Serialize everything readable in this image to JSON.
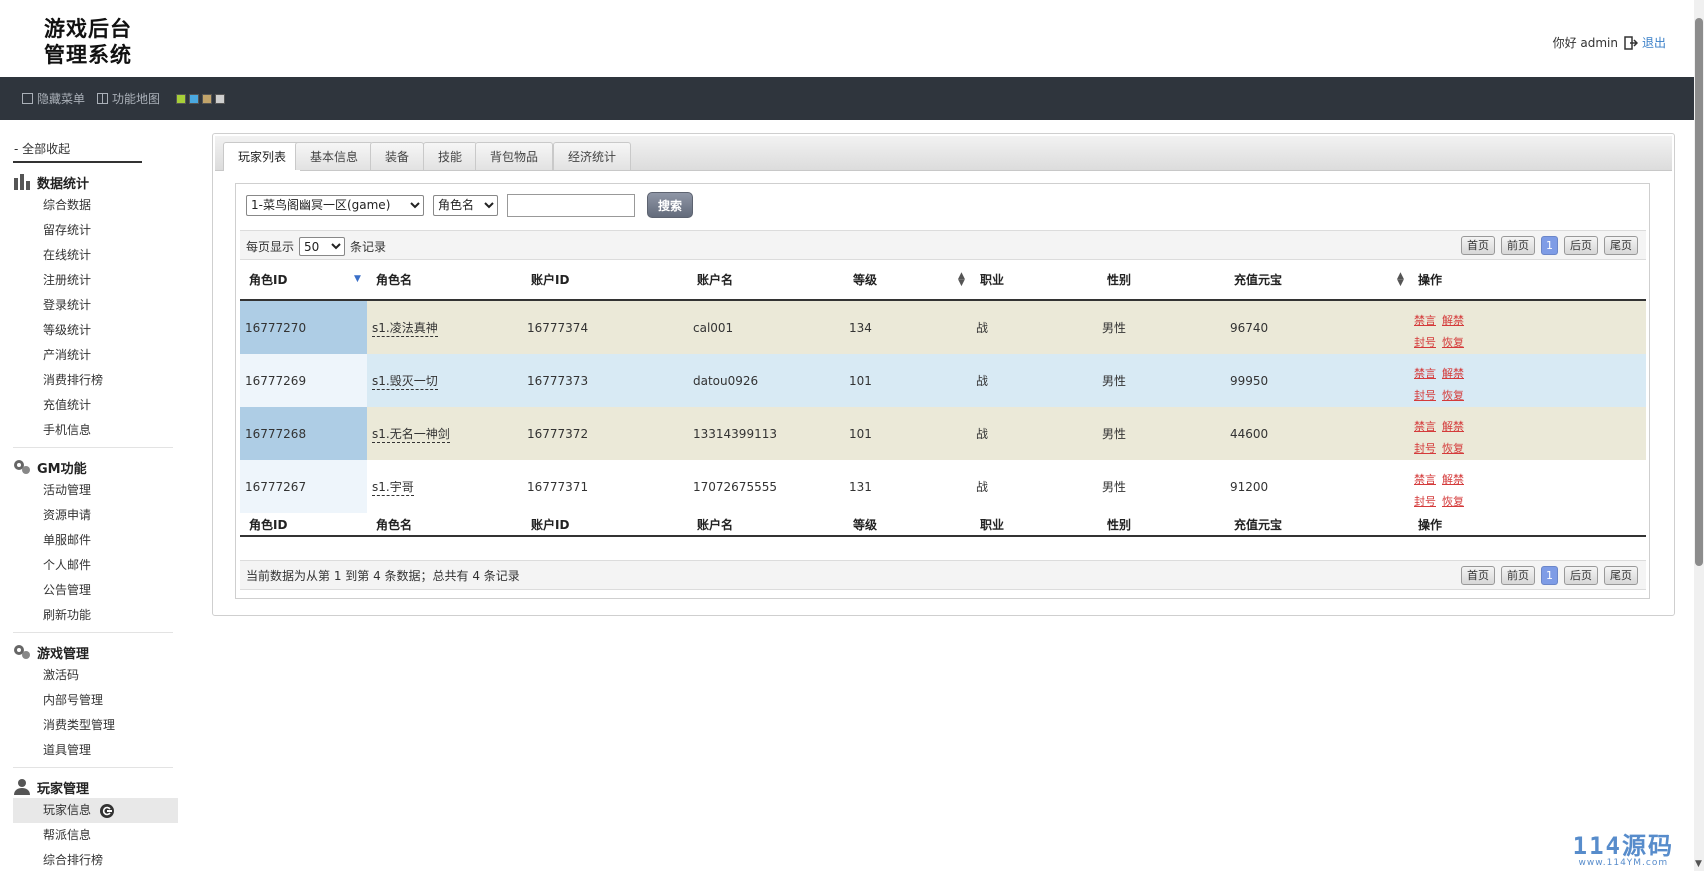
{
  "header": {
    "logo_line1": "游戏后台",
    "logo_line2": "管理系统",
    "greeting": "你好 admin",
    "logout_label": "退出"
  },
  "toolbar": {
    "hide_menu": "隐藏菜单",
    "function_map": "功能地图",
    "theme_colors": [
      "#a7cf38",
      "#4aa8e0",
      "#c2a46a",
      "#cfcfcf"
    ]
  },
  "sidebar": {
    "collapse_all": "- 全部收起",
    "groups": [
      {
        "title": "数据统计",
        "items": [
          "综合数据",
          "留存统计",
          "在线统计",
          "注册统计",
          "登录统计",
          "等级统计",
          "产消统计",
          "消费排行榜",
          "充值统计",
          "手机信息"
        ]
      },
      {
        "title": "GM功能",
        "items": [
          "活动管理",
          "资源申请",
          "单服邮件",
          "个人邮件",
          "公告管理",
          "刷新功能"
        ]
      },
      {
        "title": "游戏管理",
        "items": [
          "激活码",
          "内部号管理",
          "消费类型管理",
          "道具管理"
        ]
      },
      {
        "title": "玩家管理",
        "items": [
          "玩家信息",
          "帮派信息",
          "综合排行榜"
        ]
      }
    ]
  },
  "tabs": [
    "玩家列表",
    "基本信息",
    "装备",
    "技能",
    "背包物品",
    "经济统计"
  ],
  "search": {
    "server_selected": "1-菜鸟阁幽冥一区(game)",
    "field_selected": "角色名",
    "query_value": "",
    "button_label": "搜索"
  },
  "paging": {
    "per_page_prefix": "每页显示",
    "per_page_value": "50",
    "per_page_suffix": "条记录",
    "first": "首页",
    "prev": "前页",
    "current": "1",
    "next": "后页",
    "last": "尾页",
    "summary": "当前数据为从第 1 到第 4 条数据；总共有 4 条记录"
  },
  "table": {
    "columns": [
      "角色ID",
      "角色名",
      "账户ID",
      "账户名",
      "等级",
      "职业",
      "性别",
      "充值元宝",
      "操作"
    ],
    "rows": [
      {
        "role_id": "16777270",
        "role_name": "s1.凌法真神",
        "account_id": "16777374",
        "account_name": "cal001",
        "level": "134",
        "job": "战",
        "gender": "男性",
        "recharge": "96740"
      },
      {
        "role_id": "16777269",
        "role_name": "s1.毁灭一切",
        "account_id": "16777373",
        "account_name": "datou0926",
        "level": "101",
        "job": "战",
        "gender": "男性",
        "recharge": "99950"
      },
      {
        "role_id": "16777268",
        "role_name": "s1.无名一神剑",
        "account_id": "16777372",
        "account_name": "13314399113",
        "level": "101",
        "job": "战",
        "gender": "男性",
        "recharge": "44600"
      },
      {
        "role_id": "16777267",
        "role_name": "s1.宇哥",
        "account_id": "16777371",
        "account_name": "17072675555",
        "level": "131",
        "job": "战",
        "gender": "男性",
        "recharge": "91200"
      }
    ],
    "ops": {
      "mute": "禁言",
      "unmute": "解禁",
      "ban": "封号",
      "restore": "恢复"
    }
  },
  "watermark": {
    "big": "114源码",
    "small": "www.114YM.com"
  }
}
